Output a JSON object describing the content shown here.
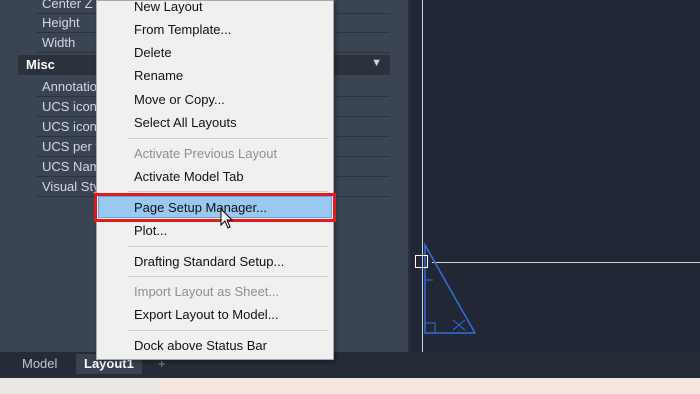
{
  "properties": {
    "top_rows": [
      "Center Z",
      "Height",
      "Width"
    ],
    "section": {
      "label": "Misc",
      "arrow": "▼"
    },
    "misc_rows": [
      "Annotation",
      "UCS icon",
      "UCS icon",
      "UCS per v",
      "UCS Name",
      "Visual Style"
    ]
  },
  "tabs": {
    "model": "Model",
    "layout": "Layout1",
    "add": "+"
  },
  "menu": {
    "new_layout": "New Layout",
    "from_template": "From Template...",
    "delete": "Delete",
    "rename": "Rename",
    "move_copy": "Move or Copy...",
    "select_all": "Select All Layouts",
    "activate_previous": "Activate Previous Layout",
    "activate_model": "Activate Model Tab",
    "page_setup": "Page Setup Manager...",
    "plot": "Plot...",
    "drafting": "Drafting Standard Setup...",
    "import_layout": "Import Layout as Sheet...",
    "export_layout": "Export Layout to Model...",
    "dock": "Dock above Status Bar"
  },
  "colors": {
    "highlight": "#99c8f0",
    "annotation_box": "#e3191c",
    "drawing_lines": "#2f6fe0"
  }
}
